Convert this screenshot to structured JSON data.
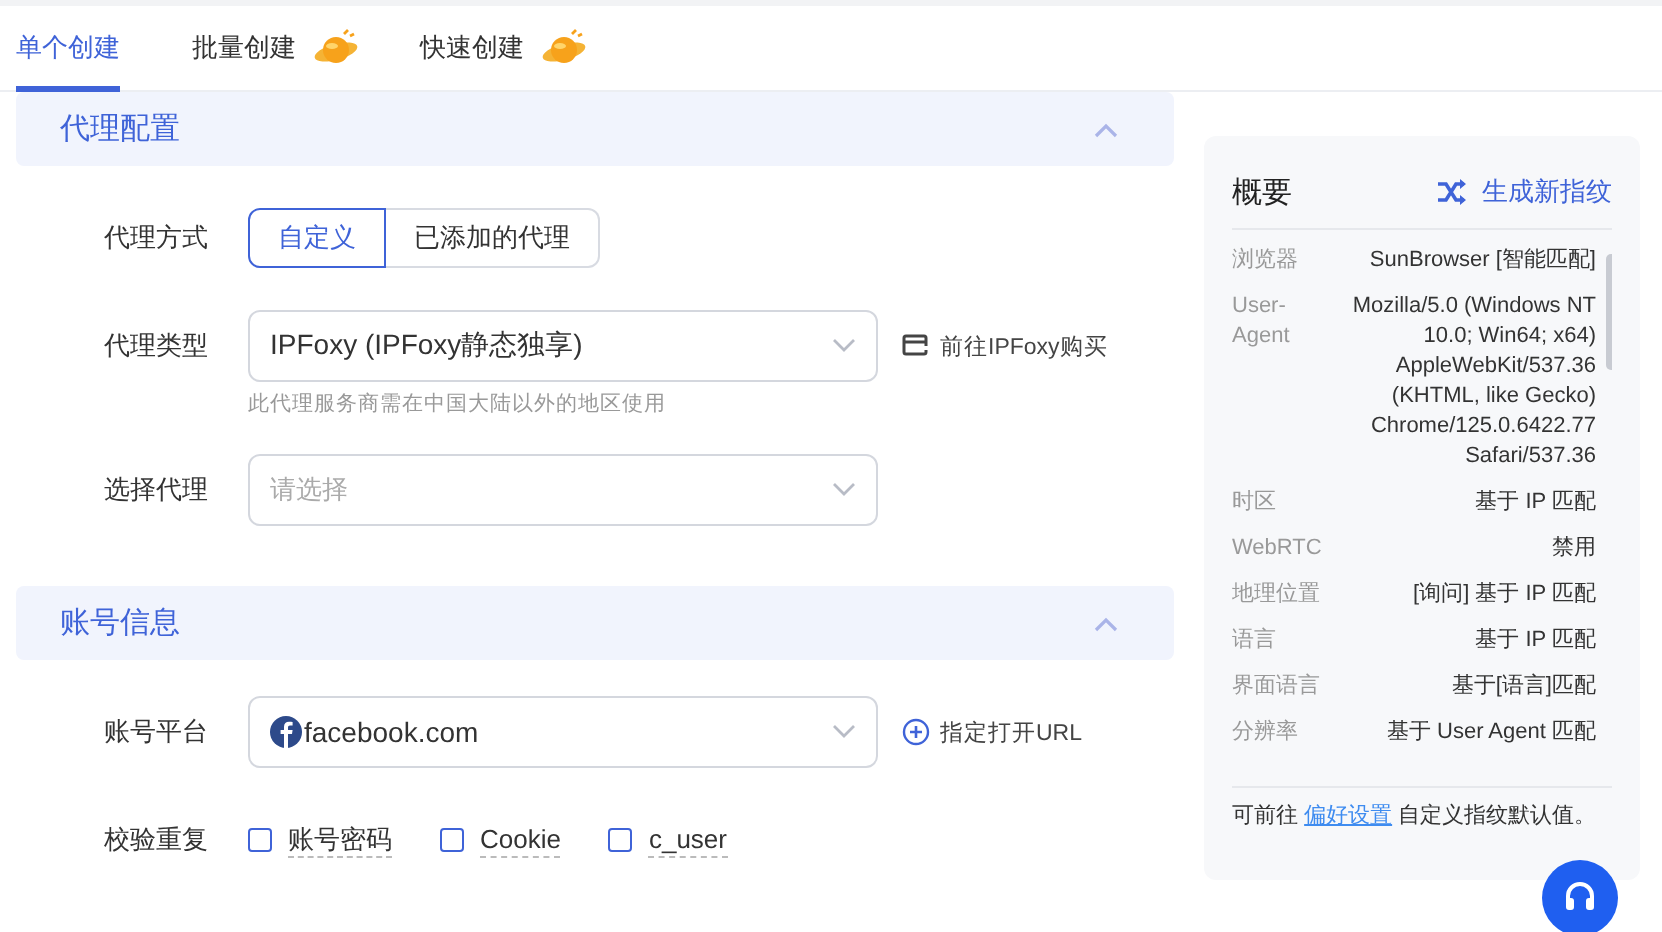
{
  "tabs": [
    {
      "label": "单个创建",
      "selected": true,
      "badge": false
    },
    {
      "label": "批量创建",
      "selected": false,
      "badge": true
    },
    {
      "label": "快速创建",
      "selected": false,
      "badge": true
    }
  ],
  "sections": [
    {
      "title": "代理配置",
      "expanded": true,
      "fields": [
        {
          "kind": "segmented",
          "label": "代理方式",
          "options": [
            {
              "label": "自定义",
              "selected": true
            },
            {
              "label": "已添加的代理",
              "selected": false
            }
          ]
        },
        {
          "kind": "select",
          "label": "代理类型",
          "value": "IPFoxy (IPFoxy静态独享)",
          "hint": "此代理服务商需在中国大陆以外的地区使用",
          "action": {
            "kind": "external",
            "text": "前往IPFoxy购买"
          }
        },
        {
          "kind": "select",
          "label": "选择代理",
          "placeholder": "请选择"
        }
      ]
    },
    {
      "title": "账号信息",
      "expanded": true,
      "fields": [
        {
          "kind": "select",
          "label": "账号平台",
          "value": "facebook.com",
          "value_logo": true,
          "action": {
            "kind": "add",
            "text": "指定打开URL"
          }
        },
        {
          "kind": "checkboxes",
          "label": "校验重复",
          "options": [
            {
              "label": "账号密码",
              "checked": false
            },
            {
              "label": "Cookie",
              "checked": false
            },
            {
              "label": "c_user",
              "checked": false
            }
          ]
        }
      ]
    }
  ],
  "summary": {
    "title": "概要",
    "action": "生成新指纹",
    "rows": [
      {
        "label": "浏览器",
        "value": "SunBrowser [智能匹配]"
      },
      {
        "label": "User-Agent",
        "value": "Mozilla/5.0 (Windows NT 10.0; Win64; x64) AppleWebKit/537.36 (KHTML, like Gecko) Chrome/125.0.6422.77 Safari/537.36"
      },
      {
        "label": "时区",
        "value": "基于 IP 匹配"
      },
      {
        "label": "WebRTC",
        "value": "禁用"
      },
      {
        "label": "地理位置",
        "value": "[询问] 基于 IP 匹配"
      },
      {
        "label": "语言",
        "value": "基于 IP 匹配"
      },
      {
        "label": "界面语言",
        "value": "基于[语言]匹配"
      },
      {
        "label": "分辨率",
        "value": "基于 User Agent 匹配"
      }
    ],
    "footer": {
      "before": "可前往 ",
      "link": "偏好设置",
      "after": " 自定义指纹默认值。"
    }
  }
}
